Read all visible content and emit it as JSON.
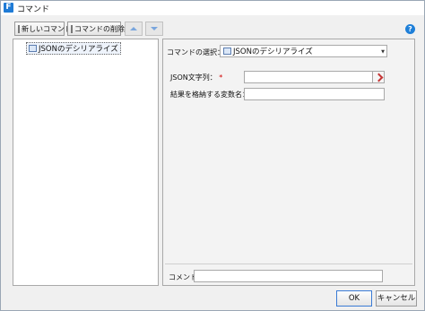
{
  "window": {
    "title": "コマンド",
    "app_icon_letter": "F"
  },
  "toolbar": {
    "new_command_label": "新しいコマンド",
    "delete_command_label": "コマンドの削除"
  },
  "tree": {
    "items": [
      {
        "label": "JSONのデシリアライズ"
      }
    ]
  },
  "form": {
    "command_select_label": "コマンドの選択：",
    "command_select_value": "JSONのデシリアライズ",
    "json_string_label": "JSON文字列：",
    "required_mark": "*",
    "json_string_value": "",
    "result_var_label": "結果を格納する変数名：",
    "result_var_value": "",
    "comment_label": "コメント",
    "comment_value": ""
  },
  "footer": {
    "ok_label": "OK",
    "cancel_label": "キャンセル"
  },
  "colors": {
    "accent": "#1e7fd8",
    "required": "#d00000"
  }
}
